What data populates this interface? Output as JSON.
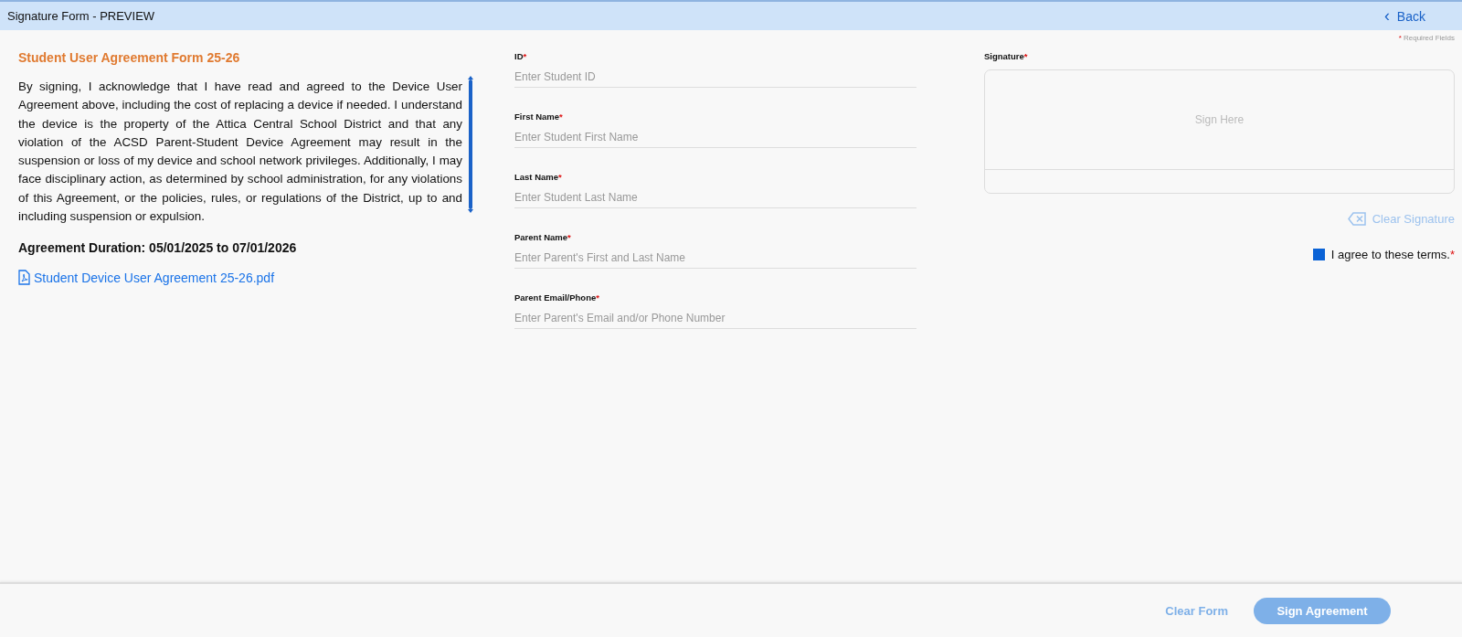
{
  "header": {
    "title": "Signature Form - PREVIEW",
    "back": {
      "icon": "‹",
      "label": "Back"
    }
  },
  "required_note": {
    "mark": "*",
    "label": "Required Fields"
  },
  "agreement": {
    "title": "Student User Agreement Form 25-26",
    "body": "By signing, I acknowledge that I have read and agreed to the Device User Agreement above, including the cost of replacing a device if needed.  I understand the device is the property of the Attica Central School District and that any violation of the ACSD Parent-Student Device Agreement may result in the suspension or loss of my device and school network privileges. Additionally, I may face disciplinary action, as determined by school administration, for any violations of this Agreement, or the policies, rules, or regulations of the District, up to and including suspension or expulsion.",
    "duration": "Agreement Duration: 05/01/2025 to 07/01/2026",
    "attachment": "Student Device User Agreement 25-26.pdf"
  },
  "fields": [
    {
      "label": "ID",
      "required": true,
      "placeholder": "Enter Student ID"
    },
    {
      "label": "First Name",
      "required": true,
      "placeholder": "Enter Student First Name"
    },
    {
      "label": "Last Name",
      "required": true,
      "placeholder": "Enter Student Last Name"
    },
    {
      "label": "Parent Name",
      "required": true,
      "placeholder": "Enter Parent's First and Last Name"
    },
    {
      "label": "Parent Email/Phone",
      "required": true,
      "placeholder": "Enter Parent's Email and/or Phone Number"
    }
  ],
  "signature": {
    "label": "Signature",
    "required": true,
    "placeholder": "Sign Here",
    "clear": {
      "label": "Clear Signature",
      "disabled": true
    }
  },
  "terms": {
    "label": "I agree to these terms.",
    "required": true,
    "checked": false
  },
  "footer": {
    "clear": {
      "label": "Clear Form",
      "disabled": true
    },
    "submit": {
      "label": "Sign Agreement",
      "disabled": true
    }
  }
}
